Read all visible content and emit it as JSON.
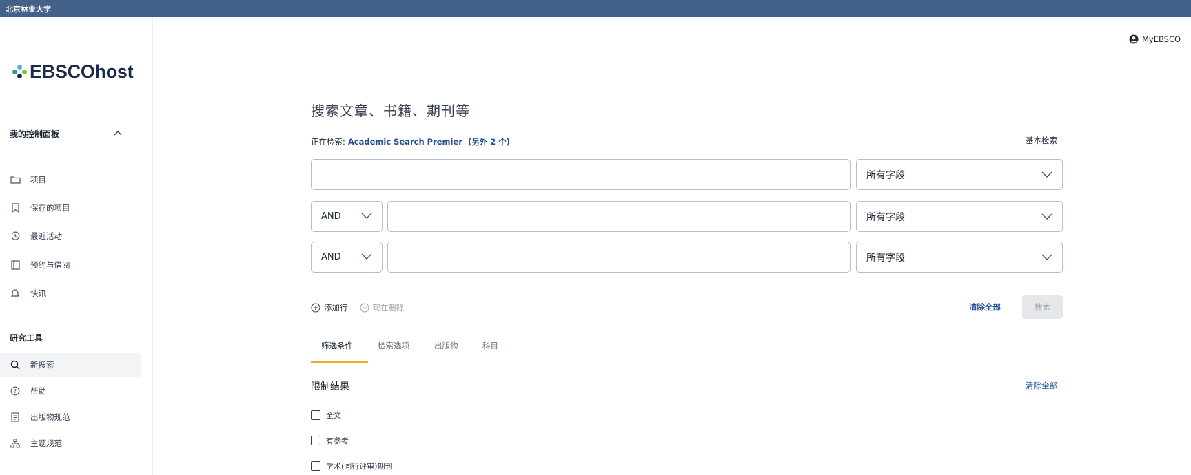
{
  "topbar": {
    "title": "北京林业大学"
  },
  "brand": {
    "logo_text": "EBSCOhost"
  },
  "sidebar": {
    "dashboard_title": "我的控制面板",
    "dashboard_items": [
      {
        "label": "项目",
        "icon": "folder-icon"
      },
      {
        "label": "保存的项目",
        "icon": "bookmark-icon"
      },
      {
        "label": "最近活动",
        "icon": "history-icon"
      },
      {
        "label": "预约与借阅",
        "icon": "book-icon"
      },
      {
        "label": "快讯",
        "icon": "bell-icon"
      }
    ],
    "tools_title": "研究工具",
    "tools_items": [
      {
        "label": "新搜索",
        "icon": "search-icon"
      },
      {
        "label": "帮助",
        "icon": "help-icon"
      },
      {
        "label": "出版物规范",
        "icon": "document-icon"
      },
      {
        "label": "主题规范",
        "icon": "hierarchy-icon"
      }
    ]
  },
  "header": {
    "myebsco_label": "MyEBSCO"
  },
  "search": {
    "title": "搜索文章、书籍、期刊等",
    "searching_prefix": "正在检索:",
    "database": "Academic Search Premier",
    "more_databases": "(另外 2 个)",
    "basic_search_link": "基本检索",
    "rows": [
      {
        "operator": "",
        "value": "",
        "field": "所有字段"
      },
      {
        "operator": "AND",
        "value": "",
        "field": "所有字段"
      },
      {
        "operator": "AND",
        "value": "",
        "field": "所有字段"
      }
    ],
    "add_row": "添加行",
    "remove_row": "现在删除",
    "clear_all": "清除全部",
    "search_button": "搜索"
  },
  "tabs": [
    {
      "label": "筛选条件",
      "active": true
    },
    {
      "label": "检索选项",
      "active": false
    },
    {
      "label": "出版物",
      "active": false
    },
    {
      "label": "科目",
      "active": false
    }
  ],
  "limits": {
    "title": "限制结果",
    "clear_all": "清除全部",
    "options": [
      {
        "label": "全文",
        "checked": false
      },
      {
        "label": "有参考",
        "checked": false
      },
      {
        "label": "学术(同行评审)期刊",
        "checked": false
      }
    ]
  },
  "colors": {
    "topbar": "#44618a",
    "link": "#1d4f91",
    "tab_accent": "#f0a830"
  }
}
